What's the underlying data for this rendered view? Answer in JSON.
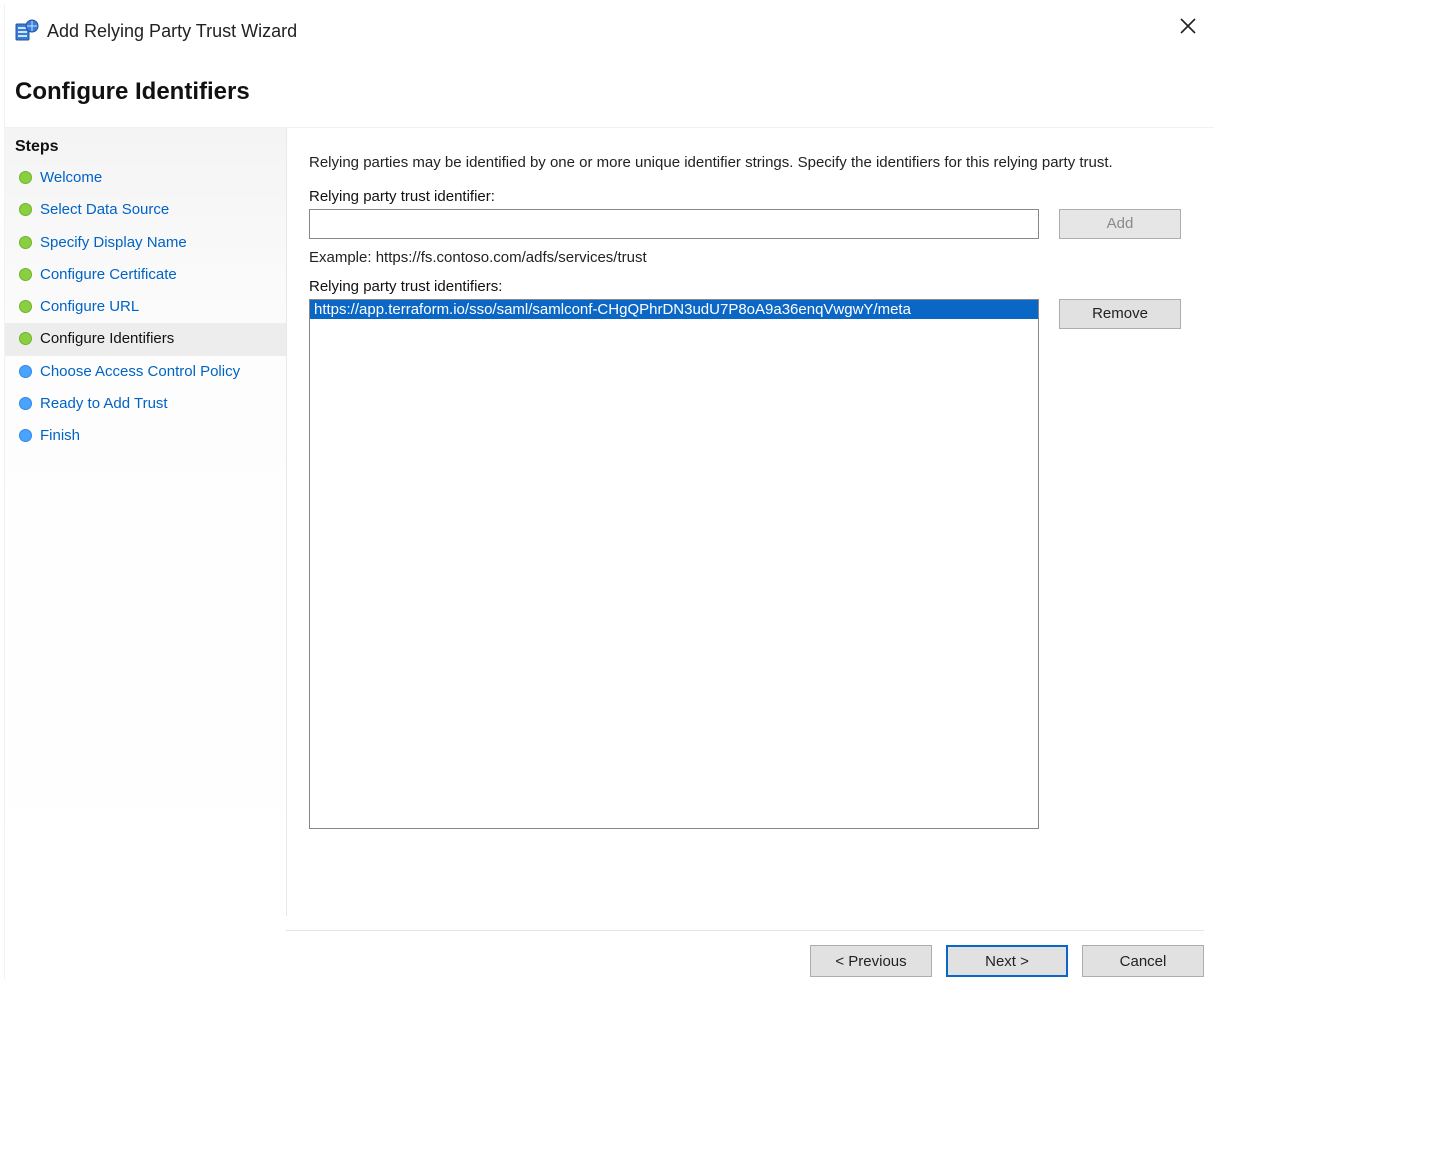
{
  "window": {
    "title": "Add Relying Party Trust Wizard"
  },
  "heading": "Configure Identifiers",
  "sidebar": {
    "title": "Steps",
    "items": [
      {
        "label": "Welcome",
        "state": "done"
      },
      {
        "label": "Select Data Source",
        "state": "done"
      },
      {
        "label": "Specify Display Name",
        "state": "done"
      },
      {
        "label": "Configure Certificate",
        "state": "done"
      },
      {
        "label": "Configure URL",
        "state": "done"
      },
      {
        "label": "Configure Identifiers",
        "state": "current"
      },
      {
        "label": "Choose Access Control Policy",
        "state": "future"
      },
      {
        "label": "Ready to Add Trust",
        "state": "future"
      },
      {
        "label": "Finish",
        "state": "future"
      }
    ]
  },
  "main": {
    "description": "Relying parties may be identified by one or more unique identifier strings. Specify the identifiers for this relying party trust.",
    "identifier_input_label": "Relying party trust identifier:",
    "identifier_input_value": "",
    "add_label": "Add",
    "example_text": "Example: https://fs.contoso.com/adfs/services/trust",
    "identifiers_list_label": "Relying party trust identifiers:",
    "identifiers": [
      {
        "value": "https://app.terraform.io/sso/saml/samlconf-CHgQPhrDN3udU7P8oA9a36enqVwgwY/meta",
        "selected": true
      }
    ],
    "remove_label": "Remove"
  },
  "footer": {
    "previous_label": "< Previous",
    "next_label": "Next >",
    "cancel_label": "Cancel"
  }
}
